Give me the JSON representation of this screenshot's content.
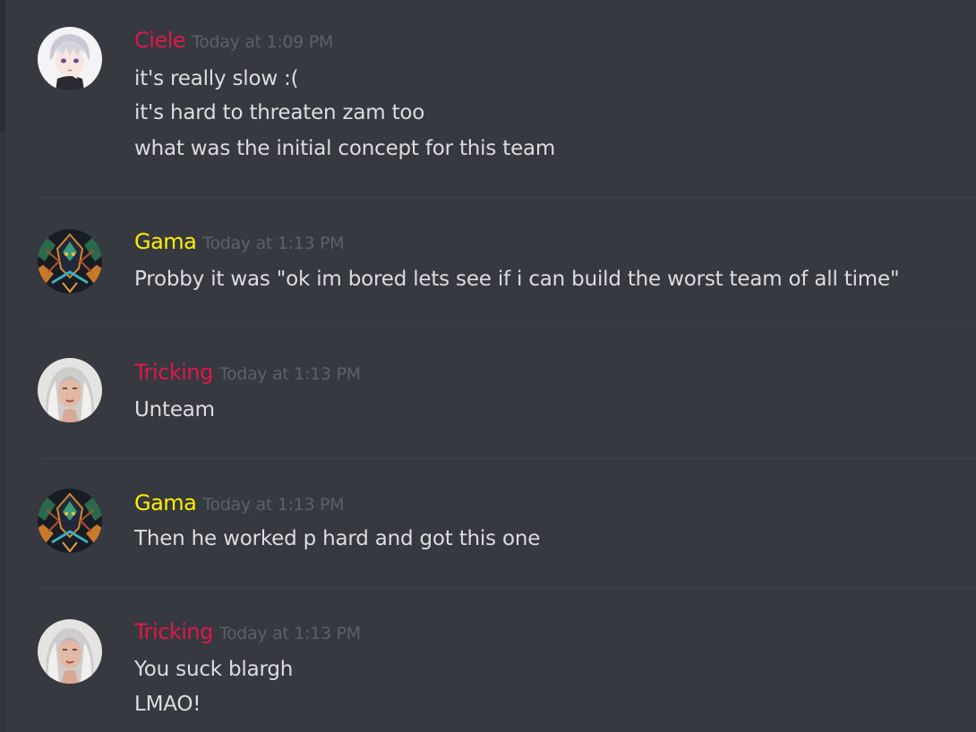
{
  "colors": {
    "background": "#36393f",
    "divider": "#40434a",
    "message_text": "#dcddde",
    "timestamp": "#5d6066",
    "role_red": "#e0174b",
    "role_yellow": "#ffee00"
  },
  "messages": [
    {
      "username": "Ciele",
      "username_color": "#e0174b",
      "timestamp": "Today at 1:09 PM",
      "avatar_icon": "anime-character-avatar",
      "lines": [
        "it's really slow :(",
        "it's hard to threaten zam too",
        "what was the initial concept for this team"
      ]
    },
    {
      "username": "Gama",
      "username_color": "#ffee00",
      "timestamp": "Today at 1:13 PM",
      "avatar_icon": "dark-magician-avatar",
      "lines": [
        "Probby it was \"ok im bored lets see if i can build the worst team of all time\""
      ]
    },
    {
      "username": "Tricking",
      "username_color": "#e0174b",
      "timestamp": "Today at 1:13 PM",
      "avatar_icon": "woman-portrait-avatar",
      "lines": [
        "Unteam"
      ]
    },
    {
      "username": "Gama",
      "username_color": "#ffee00",
      "timestamp": "Today at 1:13 PM",
      "avatar_icon": "dark-magician-avatar",
      "lines": [
        "Then he worked p hard and got this one"
      ]
    },
    {
      "username": "Tricking",
      "username_color": "#e0174b",
      "timestamp": "Today at 1:13 PM",
      "avatar_icon": "woman-portrait-avatar",
      "lines": [
        "You suck blargh",
        "LMAO!"
      ]
    }
  ]
}
